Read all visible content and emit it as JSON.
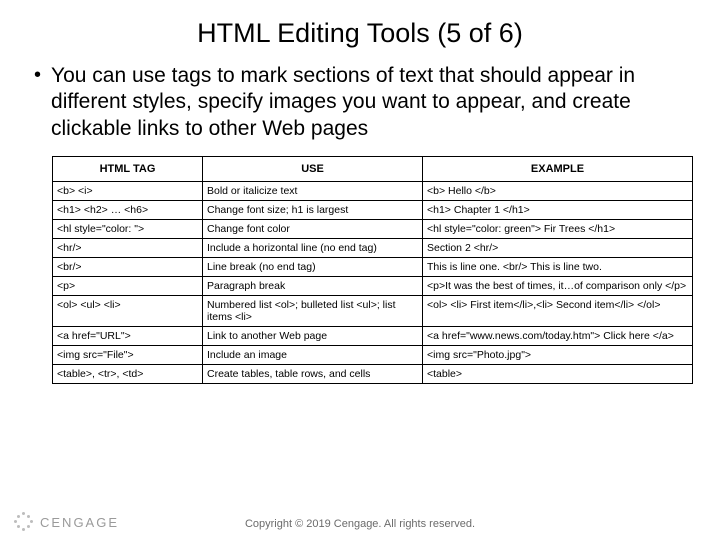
{
  "title": "HTML Editing Tools (5 of 6)",
  "bullet": "You can use tags to mark sections of text that should appear in different styles, specify images you want to appear, and create clickable links to other Web pages",
  "table": {
    "headers": [
      "HTML TAG",
      "USE",
      "EXAMPLE"
    ],
    "rows": [
      {
        "tag": "<b> <i>",
        "use": "Bold or italicize text",
        "example": "<b> Hello </b>"
      },
      {
        "tag": "<h1> <h2> … <h6>",
        "use": "Change font size; h1 is largest",
        "example": "<h1> Chapter 1 </h1>"
      },
      {
        "tag": "<hl style=\"color: \">",
        "use": "Change font color",
        "example": "<hl style=\"color: green\"> Fir Trees </h1>"
      },
      {
        "tag": "<hr/>",
        "use": "Include a horizontal line (no end tag)",
        "example": "Section 2 <hr/>"
      },
      {
        "tag": "<br/>",
        "use": "Line break (no end tag)",
        "example": "This is line one. <br/> This is line two."
      },
      {
        "tag": "<p>",
        "use": "Paragraph break",
        "example": "<p>It was the best of times, it…of comparison only </p>"
      },
      {
        "tag": "<ol> <ul> <li>",
        "use": "Numbered list <ol>; bulleted list <ul>; list items <li>",
        "example": "<ol> <li> First item</li>,<li> Second item</li> </ol>"
      },
      {
        "tag": "<a href=\"URL\">",
        "use": "Link to another Web page",
        "example": " <a href=\"www.news.com/today.htm\"> Click here </a>"
      },
      {
        "tag": "<img src=\"File\">",
        "use": "Include an image",
        "example": "<img src=\"Photo.jpg\">"
      },
      {
        "tag": "<table>, <tr>, <td>",
        "use": "Create tables, table rows, and cells",
        "example": "<table>"
      }
    ]
  },
  "brand": "CENGAGE",
  "copyright": "Copyright © 2019 Cengage. All rights reserved."
}
